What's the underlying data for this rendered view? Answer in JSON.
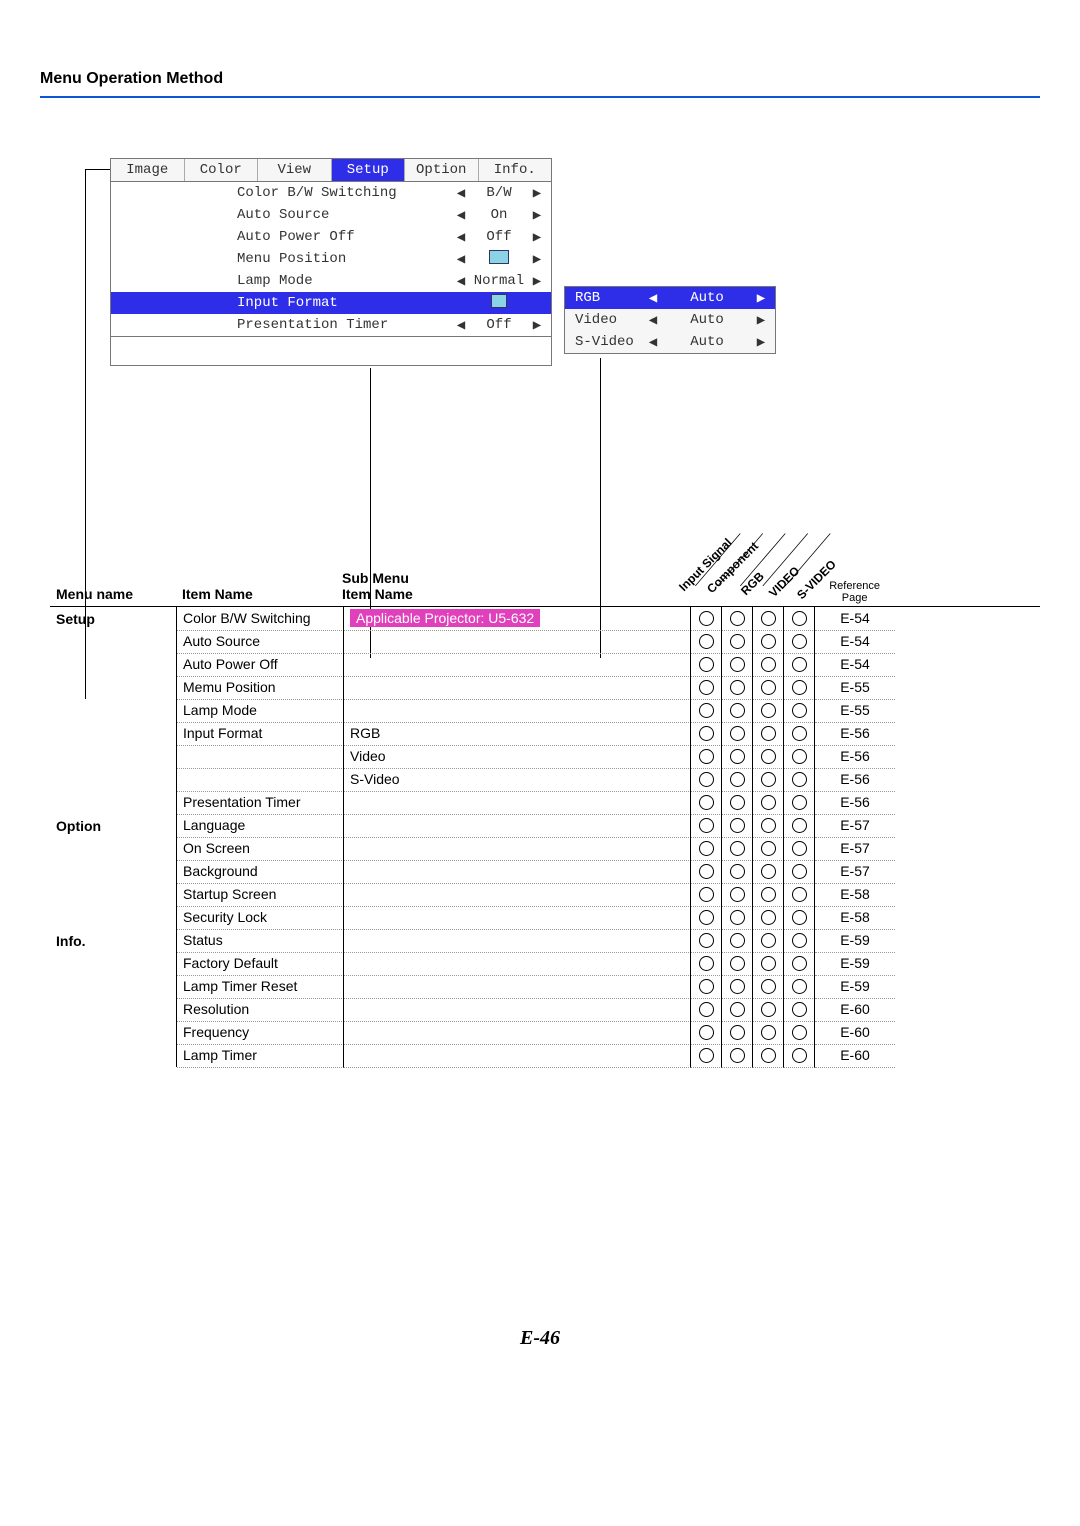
{
  "title": "Menu Operation Method",
  "page_number": "E-46",
  "osd": {
    "tabs": [
      "Image",
      "Color",
      "View",
      "Setup",
      "Option",
      "Info."
    ],
    "selected_tab_index": 3,
    "rows": [
      {
        "label": "Color B/W Switching",
        "value": "B/W",
        "selected": false,
        "type": "lr"
      },
      {
        "label": "Auto Source",
        "value": "On",
        "selected": false,
        "type": "lr"
      },
      {
        "label": "Auto Power Off",
        "value": "Off",
        "selected": false,
        "type": "lr"
      },
      {
        "label": "Menu Position",
        "value": "",
        "selected": false,
        "type": "lr-icon"
      },
      {
        "label": "Lamp Mode",
        "value": "Normal",
        "selected": false,
        "type": "lr"
      },
      {
        "label": "Input Format",
        "value": "",
        "selected": true,
        "type": "enter"
      },
      {
        "label": "Presentation Timer",
        "value": "Off",
        "selected": false,
        "type": "lr"
      }
    ],
    "sub": [
      {
        "label": "RGB",
        "value": "Auto",
        "selected": true
      },
      {
        "label": "Video",
        "value": "Auto",
        "selected": false
      },
      {
        "label": "S-Video",
        "value": "Auto",
        "selected": false
      }
    ]
  },
  "ref_headers": {
    "menu": "Menu name",
    "item": "Item Name",
    "sub": "Sub Menu\nItem Name",
    "signals": [
      "Input Signal",
      "Component",
      "RGB",
      "VIDEO",
      "S-VIDEO"
    ],
    "page": "Reference\nPage"
  },
  "note": "Applicable Projector: U5-632",
  "ref_rows": [
    {
      "menu": "Setup",
      "item": "Color B/W Switching",
      "sub": "__NOTE__",
      "s": [
        1,
        1,
        1,
        1
      ],
      "page": "E-54"
    },
    {
      "menu": "",
      "item": "Auto Source",
      "sub": "",
      "s": [
        1,
        1,
        1,
        1
      ],
      "page": "E-54"
    },
    {
      "menu": "",
      "item": "Auto Power Off",
      "sub": "",
      "s": [
        1,
        1,
        1,
        1
      ],
      "page": "E-54"
    },
    {
      "menu": "",
      "item": "Memu Position",
      "sub": "",
      "s": [
        1,
        1,
        1,
        1
      ],
      "page": "E-55"
    },
    {
      "menu": "",
      "item": "Lamp Mode",
      "sub": "",
      "s": [
        1,
        1,
        1,
        1
      ],
      "page": "E-55"
    },
    {
      "menu": "",
      "item": "Input Format",
      "sub": "RGB",
      "s": [
        1,
        1,
        1,
        1
      ],
      "page": "E-56"
    },
    {
      "menu": "",
      "item": "",
      "sub": "Video",
      "s": [
        1,
        1,
        1,
        1
      ],
      "page": "E-56"
    },
    {
      "menu": "",
      "item": "",
      "sub": "S-Video",
      "s": [
        1,
        1,
        1,
        1
      ],
      "page": "E-56"
    },
    {
      "menu": "",
      "item": "Presentation Timer",
      "sub": "",
      "s": [
        1,
        1,
        1,
        1
      ],
      "page": "E-56"
    },
    {
      "menu": "Option",
      "item": "Language",
      "sub": "",
      "s": [
        1,
        1,
        1,
        1
      ],
      "page": "E-57"
    },
    {
      "menu": "",
      "item": "On Screen",
      "sub": "",
      "s": [
        1,
        1,
        1,
        1
      ],
      "page": "E-57"
    },
    {
      "menu": "",
      "item": "Background",
      "sub": "",
      "s": [
        1,
        1,
        1,
        1
      ],
      "page": "E-57"
    },
    {
      "menu": "",
      "item": "Startup Screen",
      "sub": "",
      "s": [
        1,
        1,
        1,
        1
      ],
      "page": "E-58"
    },
    {
      "menu": "",
      "item": "Security Lock",
      "sub": "",
      "s": [
        1,
        1,
        1,
        1
      ],
      "page": "E-58"
    },
    {
      "menu": "Info.",
      "item": "Status",
      "sub": "",
      "s": [
        1,
        1,
        1,
        1
      ],
      "page": "E-59"
    },
    {
      "menu": "",
      "item": "Factory Default",
      "sub": "",
      "s": [
        1,
        1,
        1,
        1
      ],
      "page": "E-59"
    },
    {
      "menu": "",
      "item": "Lamp Timer Reset",
      "sub": "",
      "s": [
        1,
        1,
        1,
        1
      ],
      "page": "E-59"
    },
    {
      "menu": "",
      "item": "Resolution",
      "sub": "",
      "s": [
        1,
        1,
        1,
        1
      ],
      "page": "E-60"
    },
    {
      "menu": "",
      "item": "Frequency",
      "sub": "",
      "s": [
        1,
        1,
        1,
        1
      ],
      "page": "E-60"
    },
    {
      "menu": "",
      "item": "Lamp Timer",
      "sub": "",
      "s": [
        1,
        1,
        1,
        1
      ],
      "page": "E-60"
    }
  ]
}
